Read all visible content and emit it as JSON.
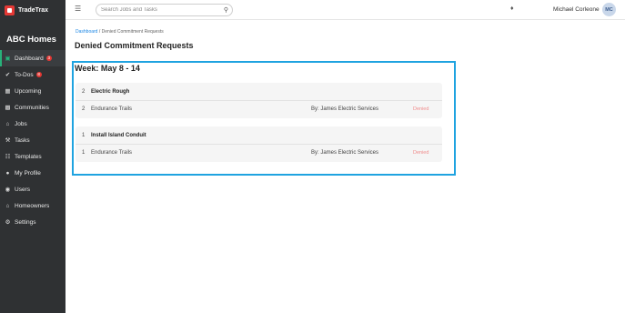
{
  "brand": {
    "name": "TradeTrax",
    "logo_icon": "tradetrax-logo-icon"
  },
  "sidebar": {
    "company": "ABC Homes",
    "items": [
      {
        "label": "Dashboard",
        "icon": "dashboard-icon",
        "badge": "3",
        "active": true
      },
      {
        "label": "To-Dos",
        "icon": "todo-icon",
        "badge": "8",
        "active": false
      },
      {
        "label": "Upcoming",
        "icon": "calendar-icon",
        "badge": "",
        "active": false
      },
      {
        "label": "Communities",
        "icon": "building-icon",
        "badge": "",
        "active": false
      },
      {
        "label": "Jobs",
        "icon": "home-icon",
        "badge": "",
        "active": false
      },
      {
        "label": "Tasks",
        "icon": "wrench-icon",
        "badge": "",
        "active": false
      },
      {
        "label": "Templates",
        "icon": "templates-icon",
        "badge": "",
        "active": false
      },
      {
        "label": "My Profile",
        "icon": "profile-icon",
        "badge": "",
        "active": false
      },
      {
        "label": "Users",
        "icon": "users-icon",
        "badge": "",
        "active": false
      },
      {
        "label": "Homeowners",
        "icon": "homeowners-icon",
        "badge": "",
        "active": false
      },
      {
        "label": "Settings",
        "icon": "gear-icon",
        "badge": "",
        "active": false
      }
    ]
  },
  "topbar": {
    "search_placeholder": "Search Jobs and Tasks",
    "user_name": "Michael Corleone",
    "avatar_initials": "MC"
  },
  "breadcrumb": {
    "link": "Dashboard",
    "separator": " / ",
    "current": "Denied Commitment Requests"
  },
  "page_title": "Denied Commitment Requests",
  "week": {
    "title": "Week: May 8 - 14"
  },
  "requests": [
    {
      "qty": "2",
      "task": "Electric Rough",
      "sub_qty": "2",
      "job": "Endurance Trails",
      "by": "By: James Electric Services",
      "status": "Denied"
    },
    {
      "qty": "1",
      "task": "Install Island Conduit",
      "sub_qty": "1",
      "job": "Endurance Trails",
      "by": "By: James Electric Services",
      "status": "Denied"
    }
  ],
  "colors": {
    "accent": "#27b27a",
    "highlight": "#1fa3e0",
    "denied": "#f08c8c",
    "badge": "#e53935",
    "link": "#1e88e5"
  }
}
